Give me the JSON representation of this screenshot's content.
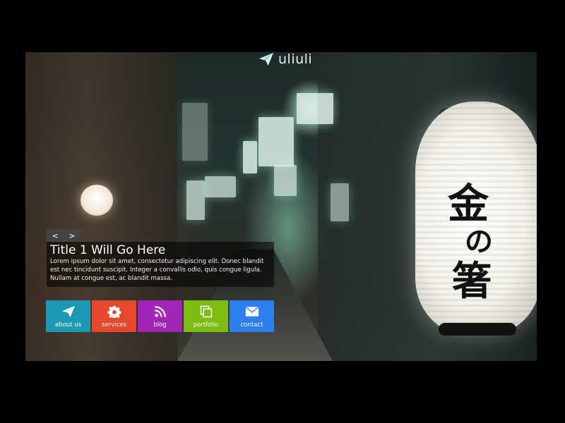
{
  "brand": {
    "name": "uliuli"
  },
  "slider": {
    "prev_label": "<",
    "next_label": ">",
    "title": "Title 1 Will Go Here",
    "text": "Lorem ipsum dolor sit amet, consectetur adipiscing elit. Donec blandit est nec tincidunt suscipit. Integer a convallis odio, quis congue ligula. Nullam at congue est, ac blandit massa."
  },
  "tiles": [
    {
      "label": "about us",
      "icon": "paper-plane-icon",
      "color": "#1b98b3"
    },
    {
      "label": "services",
      "icon": "gear-icon",
      "color": "#e5482b"
    },
    {
      "label": "blog",
      "icon": "rss-icon",
      "color": "#a126b8"
    },
    {
      "label": "portfolio",
      "icon": "stacked-squares-icon",
      "color": "#7dbd12"
    },
    {
      "label": "contact",
      "icon": "envelope-icon",
      "color": "#2d7ff0"
    }
  ]
}
